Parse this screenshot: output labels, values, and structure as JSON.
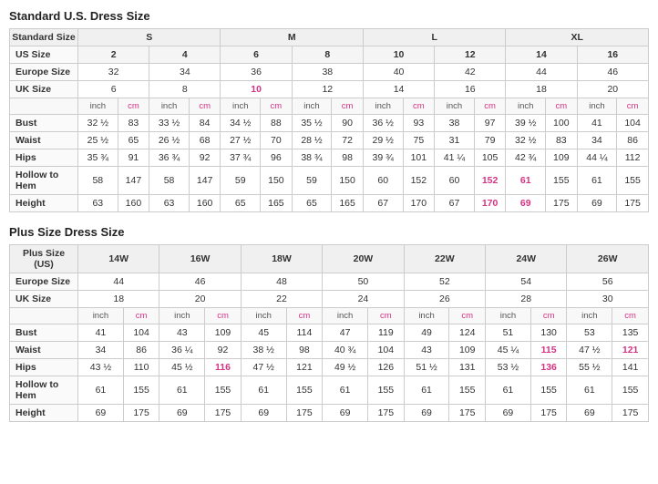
{
  "standard_title": "Standard U.S. Dress Size",
  "plus_title": "Plus Size Dress Size",
  "standard_table": {
    "size_groups": [
      {
        "label": "Standard Size",
        "cols": [
          "S",
          "",
          "M",
          "",
          "L",
          "",
          "XL",
          ""
        ]
      },
      {
        "label": "US Size",
        "cols": [
          "2",
          "4",
          "6",
          "8",
          "10",
          "12",
          "14",
          "16"
        ]
      },
      {
        "label": "Europe Size",
        "cols": [
          "32",
          "34",
          "36",
          "38",
          "40",
          "42",
          "44",
          "46"
        ]
      },
      {
        "label": "UK Size",
        "cols": [
          "6",
          "8",
          "10",
          "12",
          "14",
          "16",
          "18",
          "20"
        ],
        "highlight_cols": [
          2,
          3
        ]
      }
    ],
    "unit_row": [
      "inch",
      "cm",
      "inch",
      "cm",
      "inch",
      "cm",
      "inch",
      "cm",
      "inch",
      "cm",
      "inch",
      "cm",
      "inch",
      "cm",
      "inch",
      "cm"
    ],
    "measurements": [
      {
        "label": "Bust",
        "vals": [
          "32 ½",
          "83",
          "33 ½",
          "84",
          "34 ½",
          "88",
          "35 ½",
          "90",
          "36 ½",
          "93",
          "38",
          "97",
          "39 ½",
          "100",
          "41",
          "104"
        ]
      },
      {
        "label": "Waist",
        "vals": [
          "25 ½",
          "65",
          "26 ½",
          "68",
          "27 ½",
          "70",
          "28 ½",
          "72",
          "29 ½",
          "75",
          "31",
          "79",
          "32 ½",
          "83",
          "34",
          "86"
        ]
      },
      {
        "label": "Hips",
        "vals": [
          "35 ¾",
          "91",
          "36 ¾",
          "92",
          "37 ¾",
          "96",
          "38 ¾",
          "98",
          "39 ¾",
          "101",
          "41 ¼",
          "105",
          "42 ¾",
          "109",
          "44 ¼",
          "112"
        ]
      },
      {
        "label": "Hollow to Hem",
        "vals": [
          "58",
          "147",
          "58",
          "147",
          "59",
          "150",
          "59",
          "150",
          "60",
          "152",
          "60",
          "152",
          "61",
          "155",
          "61",
          "155"
        ],
        "highlight_vals": [
          11,
          12
        ]
      },
      {
        "label": "Height",
        "vals": [
          "63",
          "160",
          "63",
          "160",
          "65",
          "165",
          "65",
          "165",
          "67",
          "170",
          "67",
          "170",
          "69",
          "175",
          "69",
          "175"
        ],
        "highlight_vals": [
          11,
          12
        ]
      }
    ]
  },
  "plus_table": {
    "size_groups": [
      {
        "label": "Plus Size (US)",
        "cols": [
          "14W",
          "16W",
          "18W",
          "20W",
          "22W",
          "24W",
          "26W"
        ]
      },
      {
        "label": "Europe Size",
        "cols": [
          "44",
          "46",
          "48",
          "50",
          "52",
          "54",
          "56"
        ]
      },
      {
        "label": "UK Size",
        "cols": [
          "18",
          "20",
          "22",
          "24",
          "26",
          "28",
          "30"
        ]
      }
    ],
    "unit_row": [
      "inch",
      "cm",
      "inch",
      "cm",
      "inch",
      "cm",
      "inch",
      "cm",
      "inch",
      "cm",
      "inch",
      "cm",
      "inch",
      "cm"
    ],
    "measurements": [
      {
        "label": "Bust",
        "vals": [
          "41",
          "104",
          "43",
          "109",
          "45",
          "114",
          "47",
          "119",
          "49",
          "124",
          "51",
          "130",
          "53",
          "135"
        ]
      },
      {
        "label": "Waist",
        "vals": [
          "34",
          "86",
          "36 ¼",
          "92",
          "38 ½",
          "98",
          "40 ¾",
          "104",
          "43",
          "109",
          "45 ¼",
          "115",
          "47 ½",
          "121"
        ],
        "highlight_vals": [
          11,
          13
        ]
      },
      {
        "label": "Hips",
        "vals": [
          "43 ½",
          "110",
          "45 ½",
          "116",
          "47 ½",
          "121",
          "49 ½",
          "126",
          "51 ½",
          "131",
          "53 ½",
          "136",
          "55 ½",
          "141"
        ],
        "highlight_vals": [
          3,
          11
        ]
      },
      {
        "label": "Hollow to Hem",
        "vals": [
          "61",
          "155",
          "61",
          "155",
          "61",
          "155",
          "61",
          "155",
          "61",
          "155",
          "61",
          "155",
          "61",
          "155"
        ]
      },
      {
        "label": "Height",
        "vals": [
          "69",
          "175",
          "69",
          "175",
          "69",
          "175",
          "69",
          "175",
          "69",
          "175",
          "69",
          "175",
          "69",
          "175"
        ]
      }
    ]
  }
}
